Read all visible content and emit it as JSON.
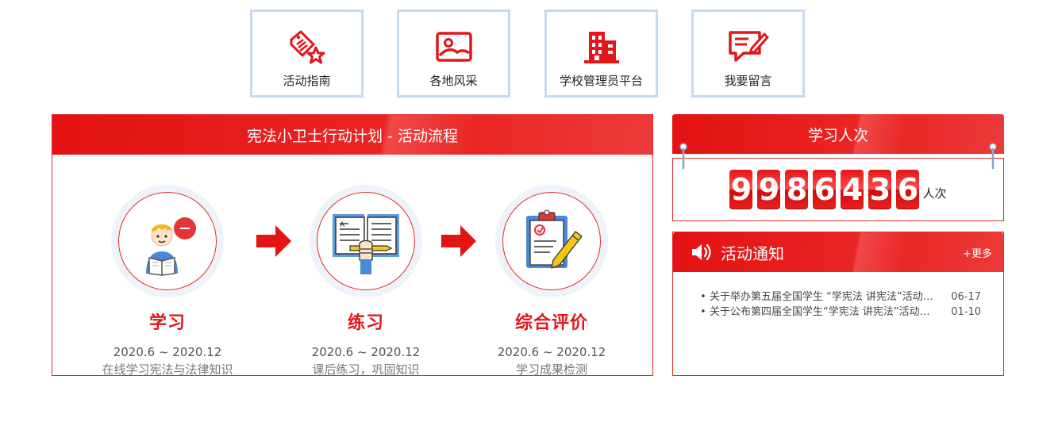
{
  "nav": [
    {
      "label": "活动指南",
      "icon": "tag-star-icon"
    },
    {
      "label": "各地风采",
      "icon": "image-icon"
    },
    {
      "label": "学校管理员平台",
      "icon": "building-icon"
    },
    {
      "label": "我要留言",
      "icon": "message-edit-icon"
    }
  ],
  "flow": {
    "title": "宪法小卫士行动计划 - 活动流程",
    "steps": [
      {
        "title": "学习",
        "date": "2020.6 ~ 2020.12",
        "desc": "在线学习宪法与法律知识",
        "icon": "student-reading-icon"
      },
      {
        "title": "练习",
        "date": "2020.6 ~ 2020.12",
        "desc": "课后练习，巩固知识",
        "icon": "book-pencil-icon"
      },
      {
        "title": "综合评价",
        "date": "2020.6 ~ 2020.12",
        "desc": "学习成果检测",
        "icon": "clipboard-check-icon"
      }
    ]
  },
  "counter": {
    "title": "学习人次",
    "digits": [
      "9",
      "9",
      "8",
      "6",
      "4",
      "3",
      "6"
    ],
    "unit": "人次"
  },
  "notice": {
    "title": "活动通知",
    "more": "+更多",
    "items": [
      {
        "text": "关于举办第五届全国学生 “学宪法 讲宪法”活动的通知",
        "date": "06-17"
      },
      {
        "text": "关于公布第四届全国学生“学宪法 讲宪法”活动结果的通知",
        "date": "01-10"
      }
    ]
  },
  "colors": {
    "brand_red": "#e3161b",
    "tile_border": "#c7d9f0"
  }
}
